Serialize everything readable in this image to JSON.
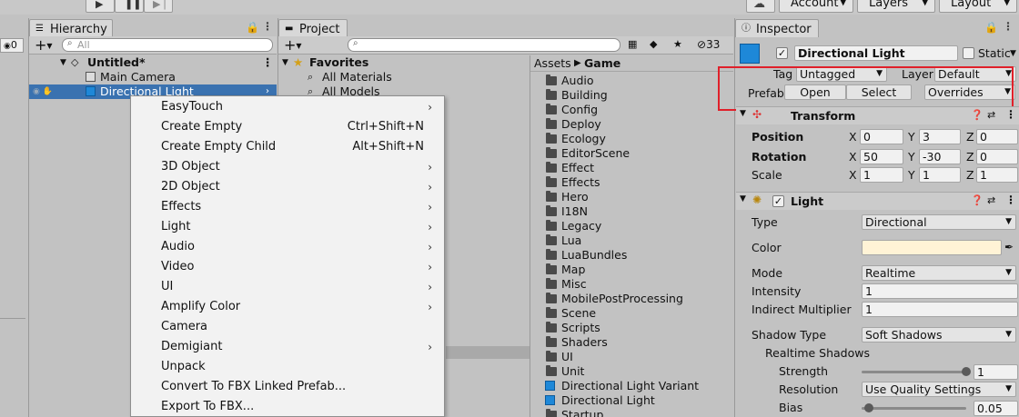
{
  "toolbar": {
    "account": "Account",
    "layers": "Layers",
    "layout": "Layout"
  },
  "hierarchy": {
    "tab": "Hierarchy",
    "search_placeholder": "All",
    "scene": "Untitled*",
    "items": [
      "Main Camera",
      "Directional Light"
    ],
    "left_count": "0"
  },
  "project": {
    "tab": "Project",
    "hidden_count": "33",
    "favorites": {
      "title": "Favorites",
      "items": [
        "All Materials",
        "All Models"
      ]
    },
    "breadcrumb": {
      "root": "Assets",
      "current": "Game"
    },
    "folders": [
      "Audio",
      "Building",
      "Config",
      "Deploy",
      "Ecology",
      "EditorScene",
      "Effect",
      "Effects",
      "Hero",
      "I18N",
      "Legacy",
      "Lua",
      "LuaBundles",
      "Map",
      "Misc",
      "MobilePostProcessing",
      "Scene",
      "Scripts",
      "Shaders",
      "UI",
      "Unit"
    ],
    "prefabs": [
      "Directional Light Variant",
      "Directional Light"
    ],
    "last_partial": "Startup"
  },
  "context_menu": {
    "items": [
      {
        "label": "EasyTouch",
        "shortcut": "",
        "submenu": true
      },
      {
        "label": "Create Empty",
        "shortcut": "Ctrl+Shift+N",
        "submenu": false
      },
      {
        "label": "Create Empty Child",
        "shortcut": "Alt+Shift+N",
        "submenu": false
      },
      {
        "label": "3D Object",
        "shortcut": "",
        "submenu": true
      },
      {
        "label": "2D Object",
        "shortcut": "",
        "submenu": true
      },
      {
        "label": "Effects",
        "shortcut": "",
        "submenu": true
      },
      {
        "label": "Light",
        "shortcut": "",
        "submenu": true
      },
      {
        "label": "Audio",
        "shortcut": "",
        "submenu": true
      },
      {
        "label": "Video",
        "shortcut": "",
        "submenu": true
      },
      {
        "label": "UI",
        "shortcut": "",
        "submenu": true
      },
      {
        "label": "Amplify Color",
        "shortcut": "",
        "submenu": true
      },
      {
        "label": "Camera",
        "shortcut": "",
        "submenu": false
      },
      {
        "label": "Demigiant",
        "shortcut": "",
        "submenu": true
      },
      {
        "label": "Unpack",
        "shortcut": "",
        "submenu": false
      },
      {
        "label": "Convert To FBX Linked Prefab...",
        "shortcut": "",
        "submenu": false
      },
      {
        "label": "Export To FBX...",
        "shortcut": "",
        "submenu": false
      }
    ]
  },
  "inspector": {
    "tab": "Inspector",
    "object_name": "Directional Light",
    "static_label": "Static",
    "tag_label": "Tag",
    "tag_value": "Untagged",
    "layer_label": "Layer",
    "layer_value": "Default",
    "prefab_label": "Prefab",
    "prefab_open": "Open",
    "prefab_select": "Select",
    "prefab_overrides": "Overrides",
    "highlight_color": "#e0202a",
    "transform": {
      "title": "Transform",
      "position_label": "Position",
      "rotation_label": "Rotation",
      "scale_label": "Scale",
      "axis_x": "X",
      "axis_y": "Y",
      "axis_z": "Z",
      "position": [
        "0",
        "3",
        "0"
      ],
      "rotation": [
        "50",
        "-30",
        "0"
      ],
      "scale": [
        "1",
        "1",
        "1"
      ]
    },
    "light": {
      "title": "Light",
      "type_label": "Type",
      "type_value": "Directional",
      "color_label": "Color",
      "color_value": "#fff3d6",
      "mode_label": "Mode",
      "mode_value": "Realtime",
      "intensity_label": "Intensity",
      "intensity_value": "1",
      "indirect_label": "Indirect Multiplier",
      "indirect_value": "1",
      "shadow_type_label": "Shadow Type",
      "shadow_type_value": "Soft Shadows",
      "realtime_shadows_label": "Realtime Shadows",
      "strength_label": "Strength",
      "strength_value": "1",
      "resolution_label": "Resolution",
      "resolution_value": "Use Quality Settings",
      "bias_label": "Bias",
      "bias_value": "0.05"
    }
  }
}
